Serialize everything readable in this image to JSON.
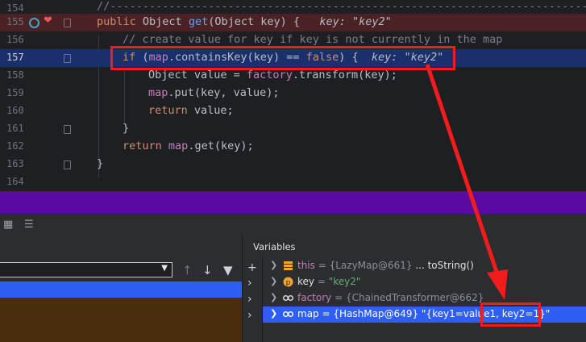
{
  "editor": {
    "lines": [
      {
        "num": "154",
        "text": "//---------------------------------------------------------------------------"
      },
      {
        "num": "155",
        "kw1": "public",
        "type": " Object ",
        "fn": "get",
        "rest": "(Object key) {",
        "hint": "key: \"key2\""
      },
      {
        "num": "156",
        "comment": "// create value for key if key is not currently in the map"
      },
      {
        "num": "157",
        "kw1": "if",
        "p1": " (",
        "fld": "map",
        "p2": ".containsKey(key) == ",
        "kw2": "false",
        "p3": ") {",
        "hint": "key: \"key2\""
      },
      {
        "num": "158",
        "p1": "Object value = ",
        "fld": "factory",
        "p2": ".transform(key);"
      },
      {
        "num": "159",
        "fld": "map",
        "p2": ".put(key, value);"
      },
      {
        "num": "160",
        "kw1": "return",
        "p2": " value;"
      },
      {
        "num": "161",
        "p2": "}"
      },
      {
        "num": "162",
        "kw1": "return",
        "p1": " ",
        "fld": "map",
        "p2": ".get(key);"
      },
      {
        "num": "163",
        "p2": "}"
      },
      {
        "num": "164"
      }
    ]
  },
  "frames": {},
  "variables": {
    "title": "Variables",
    "rows": [
      {
        "name": "this",
        "eq": " = ",
        "value": "{LazyMap@661}",
        "link": " ... toString()",
        "icon": "field-icon"
      },
      {
        "name": "key",
        "eq": " = ",
        "value": "\"key2\"",
        "icon": "parameter-icon"
      },
      {
        "name": "factory",
        "eq": " = ",
        "value": "{ChainedTransformer@662}",
        "icon": "watch-icon"
      },
      {
        "name": "map",
        "eq": " = ",
        "value": "{HashMap@649}",
        "extra": " \"{key1=value1, key2=1}\"",
        "icon": "watch-icon"
      }
    ]
  },
  "colors": {
    "accent": "#2f5ef5",
    "annotation": "#f21c1c",
    "breakpoint_line": "#4a2226"
  }
}
